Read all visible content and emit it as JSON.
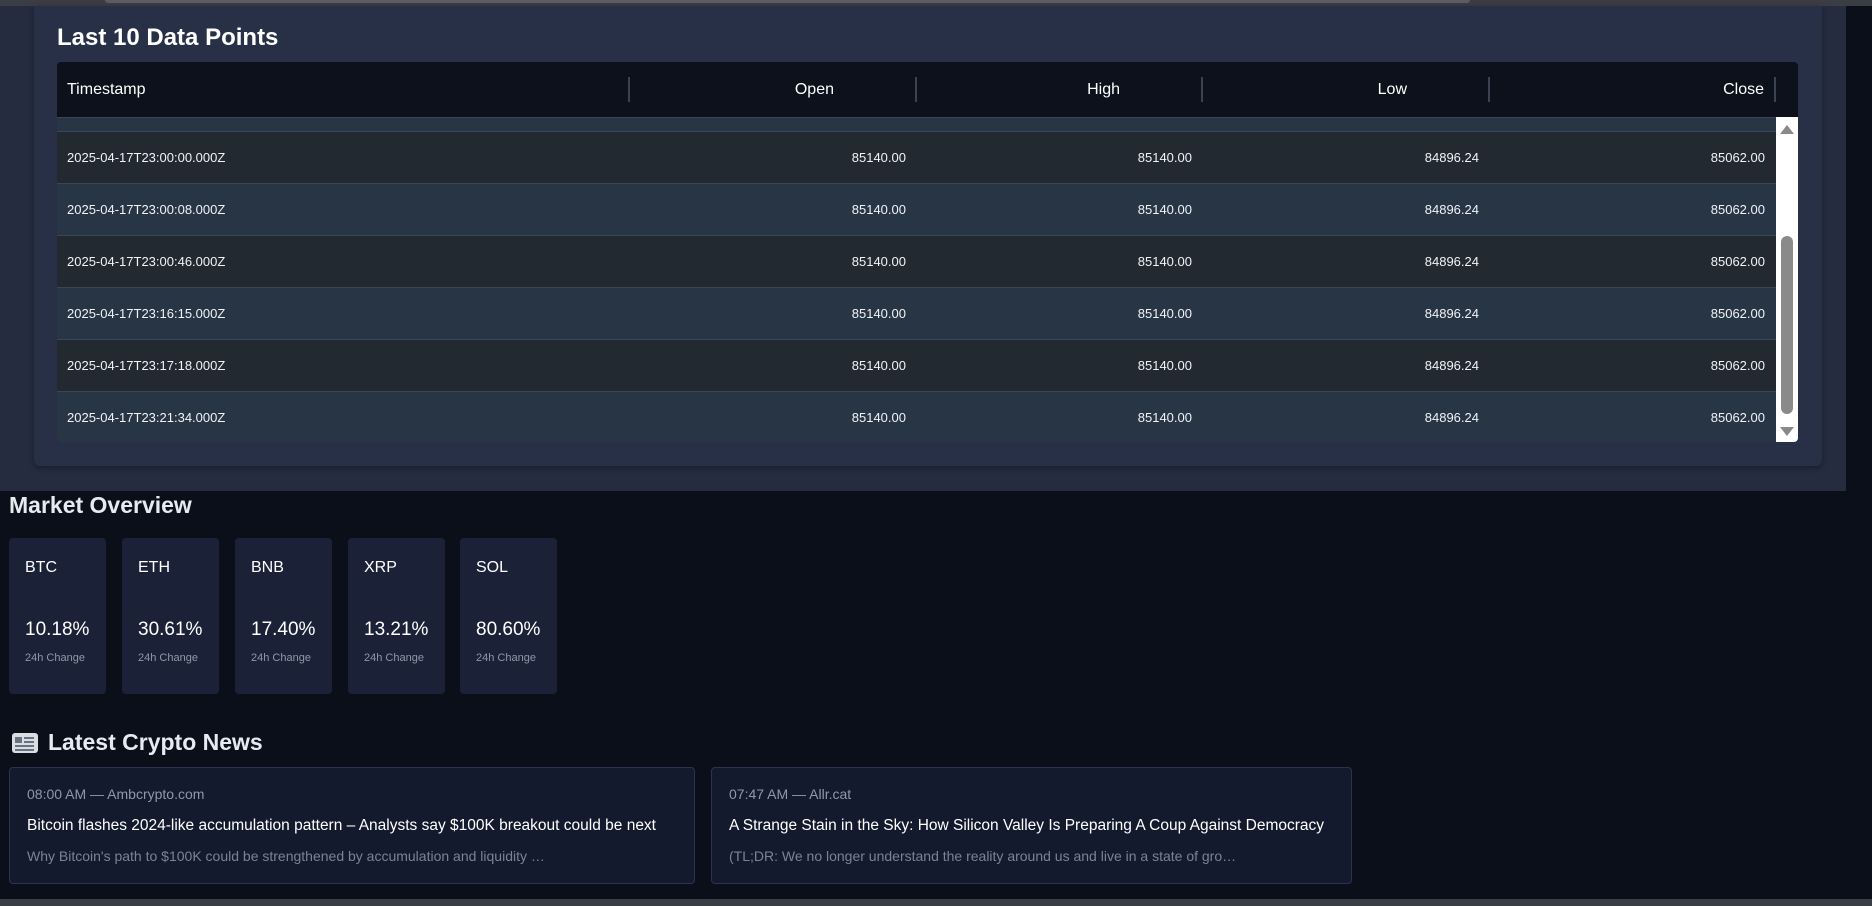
{
  "data_points": {
    "title": "Last 10 Data Points",
    "columns": [
      "Timestamp",
      "Open",
      "High",
      "Low",
      "Close"
    ],
    "rows": [
      [
        "2025-04-17T23:00:00.000Z",
        "85140.00",
        "85140.00",
        "84896.24",
        "85062.00"
      ],
      [
        "2025-04-17T23:00:08.000Z",
        "85140.00",
        "85140.00",
        "84896.24",
        "85062.00"
      ],
      [
        "2025-04-17T23:00:46.000Z",
        "85140.00",
        "85140.00",
        "84896.24",
        "85062.00"
      ],
      [
        "2025-04-17T23:16:15.000Z",
        "85140.00",
        "85140.00",
        "84896.24",
        "85062.00"
      ],
      [
        "2025-04-17T23:17:18.000Z",
        "85140.00",
        "85140.00",
        "84896.24",
        "85062.00"
      ],
      [
        "2025-04-17T23:21:34.000Z",
        "85140.00",
        "85140.00",
        "84896.24",
        "85062.00"
      ]
    ]
  },
  "market_overview": {
    "title": "Market Overview",
    "cards": [
      {
        "symbol": "BTC",
        "change": "10.18%",
        "label": "24h Change"
      },
      {
        "symbol": "ETH",
        "change": "30.61%",
        "label": "24h Change"
      },
      {
        "symbol": "BNB",
        "change": "17.40%",
        "label": "24h Change"
      },
      {
        "symbol": "XRP",
        "change": "13.21%",
        "label": "24h Change"
      },
      {
        "symbol": "SOL",
        "change": "80.60%",
        "label": "24h Change"
      }
    ]
  },
  "news": {
    "title": "Latest Crypto News",
    "icon": "newspaper-icon",
    "items": [
      {
        "meta": "08:00 AM — Ambcrypto.com",
        "headline": "Bitcoin flashes 2024-like accumulation pattern – Analysts say $100K breakout could be next",
        "summary": "Why Bitcoin's path to $100K could be strengthened by accumulation and liquidity …"
      },
      {
        "meta": "07:47 AM — Allr.cat",
        "headline": "A Strange Stain in the Sky: How Silicon Valley Is Preparing A Coup Against Democracy",
        "summary": "(TL;DR: We no longer understand the reality around us and live in a state of gro…"
      }
    ]
  }
}
